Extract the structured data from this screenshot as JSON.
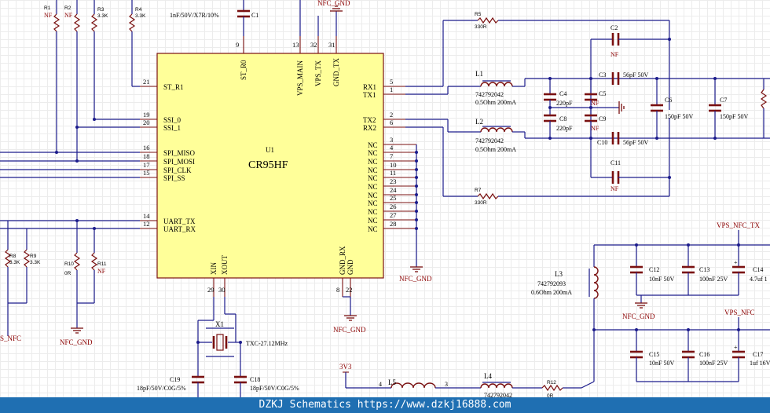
{
  "ic": {
    "ref": "U1",
    "part": "CR95HF",
    "left_pins": [
      {
        "num": "21",
        "name": "ST_R1"
      },
      {
        "num": "19",
        "name": "SSI_0"
      },
      {
        "num": "20",
        "name": "SSI_1"
      },
      {
        "num": "16",
        "name": "SPI_MISO"
      },
      {
        "num": "18",
        "name": "SPI_MOSI"
      },
      {
        "num": "17",
        "name": "SPI_CLK"
      },
      {
        "num": "15",
        "name": "SPI_SS"
      },
      {
        "num": "14",
        "name": "UART_TX"
      },
      {
        "num": "12",
        "name": "UART_RX"
      }
    ],
    "top_pins": [
      {
        "num": "9",
        "name": "ST_R0"
      },
      {
        "num": "13",
        "name": "VPS_MAIN"
      },
      {
        "num": "32",
        "name": "VPS_TX"
      },
      {
        "num": "31",
        "name": "GND_TX"
      }
    ],
    "right_pins": [
      {
        "num": "5",
        "name": "RX1"
      },
      {
        "num": "1",
        "name": "TX1"
      },
      {
        "num": "2",
        "name": "TX2"
      },
      {
        "num": "6",
        "name": "RX2"
      }
    ],
    "nc_pins": [
      "3",
      "4",
      "7",
      "10",
      "11",
      "23",
      "24",
      "25",
      "26",
      "27",
      "28"
    ],
    "nc_label": "NC",
    "bottom_pins": [
      {
        "num": "29",
        "name": "XIN"
      },
      {
        "num": "30",
        "name": "XOUT"
      },
      {
        "num": "8",
        "name": "GND_RX"
      },
      {
        "num": "22",
        "name": "GND"
      }
    ]
  },
  "labels": {
    "r1": {
      "ref": "R1",
      "val": "NF"
    },
    "r2": {
      "ref": "R2",
      "val": "NF"
    },
    "r3": {
      "ref": "R3",
      "val": "3.3K"
    },
    "r4": {
      "ref": "R4",
      "val": "3.3K"
    },
    "r8": {
      "ref": "R8",
      "val": "3.3K"
    },
    "r9": {
      "ref": "R9",
      "val": "3.3K"
    },
    "r10": {
      "ref": "R10",
      "val": "0R"
    },
    "r11": {
      "ref": "R11",
      "val": "NF"
    },
    "r5": {
      "ref": "R5",
      "val": "330R"
    },
    "r7": {
      "ref": "R7",
      "val": "330R"
    },
    "r12": {
      "ref": "R12",
      "val": "0R"
    },
    "c1": {
      "ref": "C1",
      "val": "1nF/50V/X7R/10%"
    },
    "c2": {
      "ref": "C2",
      "val": "NF"
    },
    "c3": {
      "ref": "C3",
      "val": "56pF 50V"
    },
    "c4": {
      "ref": "C4",
      "val": "220pF"
    },
    "c5": {
      "ref": "C5",
      "val": "NF"
    },
    "c6": {
      "ref": "C6",
      "val": "150pF 50V"
    },
    "c7": {
      "ref": "C7",
      "val": "150pF 50V"
    },
    "c8": {
      "ref": "C8",
      "val": "220pF"
    },
    "c9": {
      "ref": "C9",
      "val": "NF"
    },
    "c10": {
      "ref": "C10",
      "val": "56pF 50V"
    },
    "c11": {
      "ref": "C11",
      "val": "NF"
    },
    "c12": {
      "ref": "C12",
      "val": "10nF 50V"
    },
    "c13": {
      "ref": "C13",
      "val": "100nF 25V"
    },
    "c14": {
      "ref": "C14",
      "val": "4.7uf 1"
    },
    "c15": {
      "ref": "C15",
      "val": "10nF 50V"
    },
    "c16": {
      "ref": "C16",
      "val": "100nF 25V"
    },
    "c17": {
      "ref": "C17",
      "val": "1uf 16V"
    },
    "c18": {
      "ref": "C18",
      "val": "18pF/50V/C0G/5%"
    },
    "c19": {
      "ref": "C19",
      "val": "18pF/50V/C0G/5%"
    },
    "l1": {
      "ref": "L1",
      "part": "742792042",
      "spec": "0.5Ohm 200mA"
    },
    "l2": {
      "ref": "L2",
      "part": "742792042",
      "spec": "0.5Ohm 200mA"
    },
    "l3": {
      "ref": "L3",
      "part": "742792093",
      "spec": "0.6Ohm 200mA"
    },
    "l4": {
      "ref": "L4",
      "part": "742792042"
    },
    "l5": {
      "ref": "L5",
      "pin_a": "4",
      "pin_b": "3"
    },
    "x1": {
      "ref": "X1",
      "val": "TXC-27.12MHz"
    }
  },
  "nets": {
    "nfc_gnd": "NFC_GND",
    "vps_nfc_tx": "VPS_NFC_TX",
    "vps_nfc": "VPS_NFC",
    "v3v3": "3V3",
    "s_nfc": "S_NFC"
  },
  "footer": {
    "text": "DZKJ Schematics https://www.dzkj16888.com"
  }
}
